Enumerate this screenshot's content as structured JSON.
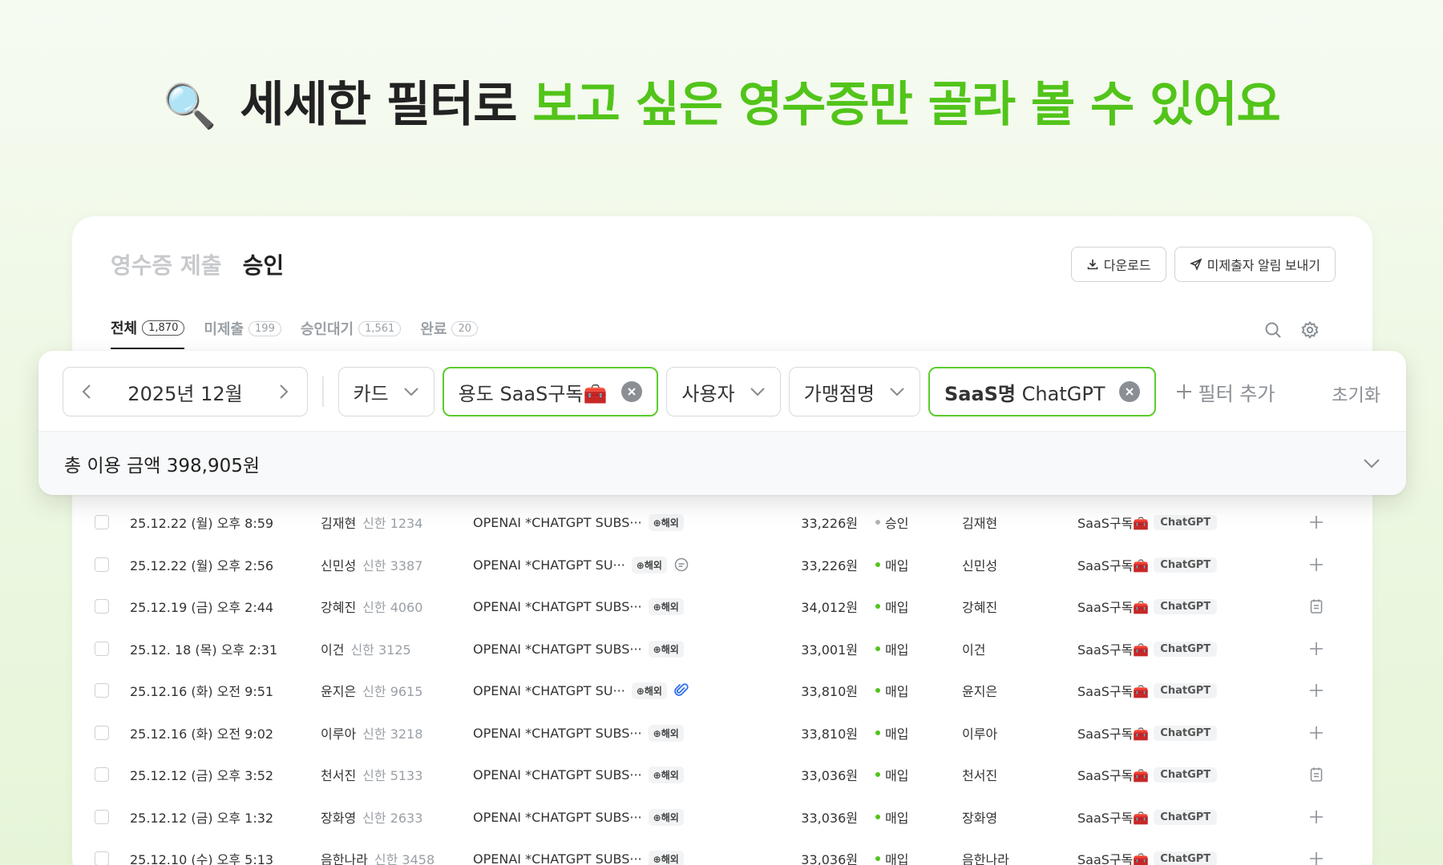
{
  "headline": {
    "icon": "🔍",
    "dark": "세세한 필터로",
    "green": "보고 싶은 영수증만 골라 볼 수 있어요"
  },
  "title_tabs": {
    "inactive": "영수증 제출",
    "active": "승인"
  },
  "buttons": {
    "download": "다운로드",
    "notify": "미제출자 알림 보내기"
  },
  "subtabs": [
    {
      "label": "전체",
      "count": "1,870"
    },
    {
      "label": "미제출",
      "count": "199"
    },
    {
      "label": "승인대기",
      "count": "1,561"
    },
    {
      "label": "완료",
      "count": "20"
    }
  ],
  "filters": {
    "month": "2025년 12월",
    "card": "카드",
    "purpose_chip": "용도 SaaS구독🧰",
    "user": "사용자",
    "merchant": "가맹점명",
    "saas_chip_key": "SaaS명",
    "saas_chip_value": "ChatGPT",
    "add_filter": "필터 추가",
    "reset": "초기화"
  },
  "total": "총 이용 금액 398,905원",
  "colors": {
    "accent": "#52c41a",
    "chip_border": "#5ccc2c",
    "status_approved": "#b0b4b8",
    "status_purchase": "#52c41a"
  },
  "rows": [
    {
      "date": "25.12.22 (월) 오후 8:59",
      "user": "김재현",
      "card": "신한 1234",
      "merchant": "OPENAI *CHATGPT SUBS···",
      "foreign": "⊕해외",
      "extra": "",
      "amount": "33,226원",
      "status": "승인",
      "status_type": "approved",
      "person": "김재현",
      "purpose": "SaaS구독🧰",
      "saas": "ChatGPT",
      "action": "plus"
    },
    {
      "date": "25.12.22 (월) 오후 2:56",
      "user": "신민성",
      "card": "신한 3387",
      "merchant": "OPENAI *CHATGPT SU···",
      "foreign": "⊕해외",
      "extra": "comment",
      "amount": "33,226원",
      "status": "매입",
      "status_type": "purchase",
      "person": "신민성",
      "purpose": "SaaS구독🧰",
      "saas": "ChatGPT",
      "action": "plus"
    },
    {
      "date": "25.12.19 (금) 오후 2:44",
      "user": "강혜진",
      "card": "신한 4060",
      "merchant": "OPENAI *CHATGPT SUBS···",
      "foreign": "⊕해외",
      "extra": "",
      "amount": "34,012원",
      "status": "매입",
      "status_type": "purchase",
      "person": "강혜진",
      "purpose": "SaaS구독🧰",
      "saas": "ChatGPT",
      "action": "receipt"
    },
    {
      "date": "25.12. 18 (목) 오후 2:31",
      "user": "이건",
      "card": "신한 3125",
      "merchant": "OPENAI *CHATGPT SUBS···",
      "foreign": "⊕해외",
      "extra": "",
      "amount": "33,001원",
      "status": "매입",
      "status_type": "purchase",
      "person": "이건",
      "purpose": "SaaS구독🧰",
      "saas": "ChatGPT",
      "action": "plus"
    },
    {
      "date": "25.12.16 (화) 오전 9:51",
      "user": "윤지은",
      "card": "신한 9615",
      "merchant": "OPENAI *CHATGPT SU···",
      "foreign": "⊕해외",
      "extra": "attachment",
      "amount": "33,810원",
      "status": "매입",
      "status_type": "purchase",
      "person": "윤지은",
      "purpose": "SaaS구독🧰",
      "saas": "ChatGPT",
      "action": "plus"
    },
    {
      "date": "25.12.16 (화) 오전 9:02",
      "user": "이루아",
      "card": "신한 3218",
      "merchant": "OPENAI *CHATGPT SUBS···",
      "foreign": "⊕해외",
      "extra": "",
      "amount": "33,810원",
      "status": "매입",
      "status_type": "purchase",
      "person": "이루아",
      "purpose": "SaaS구독🧰",
      "saas": "ChatGPT",
      "action": "plus"
    },
    {
      "date": "25.12.12 (금) 오후 3:52",
      "user": "천서진",
      "card": "신한 5133",
      "merchant": "OPENAI *CHATGPT SUBS···",
      "foreign": "⊕해외",
      "extra": "",
      "amount": "33,036원",
      "status": "매입",
      "status_type": "purchase",
      "person": "천서진",
      "purpose": "SaaS구독🧰",
      "saas": "ChatGPT",
      "action": "receipt"
    },
    {
      "date": "25.12.12 (금) 오후 1:32",
      "user": "장화영",
      "card": "신한 2633",
      "merchant": "OPENAI *CHATGPT SUBS···",
      "foreign": "⊕해외",
      "extra": "",
      "amount": "33,036원",
      "status": "매입",
      "status_type": "purchase",
      "person": "장화영",
      "purpose": "SaaS구독🧰",
      "saas": "ChatGPT",
      "action": "plus"
    },
    {
      "date": "25.12.10 (수) 오후 5:13",
      "user": "음한나라",
      "card": "신한 3458",
      "merchant": "OPENAI *CHATGPT SUBS···",
      "foreign": "⊕해외",
      "extra": "",
      "amount": "33,036원",
      "status": "매입",
      "status_type": "purchase",
      "person": "음한나라",
      "purpose": "SaaS구독🧰",
      "saas": "ChatGPT",
      "action": "plus"
    }
  ]
}
